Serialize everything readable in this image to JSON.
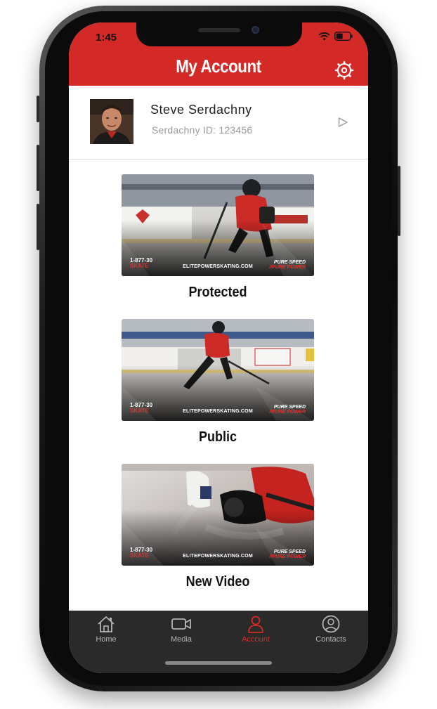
{
  "status_bar": {
    "time": "1:45"
  },
  "header": {
    "title": "My Account"
  },
  "profile": {
    "name": "Steve Serdachny",
    "id_text": "Serdachny ID: 123456"
  },
  "thumbnail_text": {
    "left_phone": "1-877-30",
    "left_skate": "SKATE",
    "website": "ELITEPOWERSKATING.COM",
    "right_top": "PURE SPEED",
    "right_bottom": "//PURE POWER"
  },
  "categories": [
    {
      "label": "Protected"
    },
    {
      "label": "Public"
    },
    {
      "label": "New Video"
    }
  ],
  "tabbar": {
    "items": [
      {
        "label": "Home",
        "icon": "home-icon"
      },
      {
        "label": "Media",
        "icon": "video-camera-icon"
      },
      {
        "label": "Account",
        "icon": "person-icon",
        "active": true
      },
      {
        "label": "Contacts",
        "icon": "contacts-icon"
      }
    ]
  },
  "colors": {
    "brand_red": "#d42a27",
    "tabbar_bg": "#2a2a2a",
    "tab_inactive": "#b4b4b4"
  }
}
